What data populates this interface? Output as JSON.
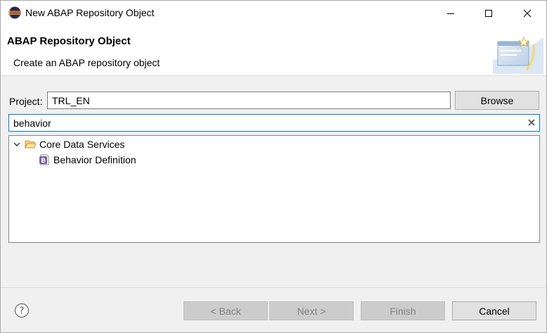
{
  "window": {
    "title": "New ABAP Repository Object",
    "controls": {
      "minimize": "minimize-icon",
      "maximize": "maximize-icon",
      "close": "close-icon"
    }
  },
  "header": {
    "title": "ABAP Repository Object",
    "description": "Create an ABAP repository object"
  },
  "form": {
    "project_label": "Project:",
    "project_value": "TRL_EN",
    "browse_label": "Browse",
    "search_value": "behavior"
  },
  "tree": {
    "items": [
      {
        "label": "Core Data Services",
        "icon": "folder-open-icon",
        "expanded": true
      },
      {
        "label": "Behavior Definition",
        "icon": "behavior-definition-icon"
      }
    ]
  },
  "footer": {
    "back_label": "< Back",
    "next_label": "Next >",
    "finish_label": "Finish",
    "cancel_label": "Cancel"
  },
  "colors": {
    "focus_border": "#0078d7",
    "disabled_button": "#cccccc",
    "disabled_text": "#838383",
    "folder": "#e8b84a",
    "bdef_icon": "#7b5ea7"
  }
}
